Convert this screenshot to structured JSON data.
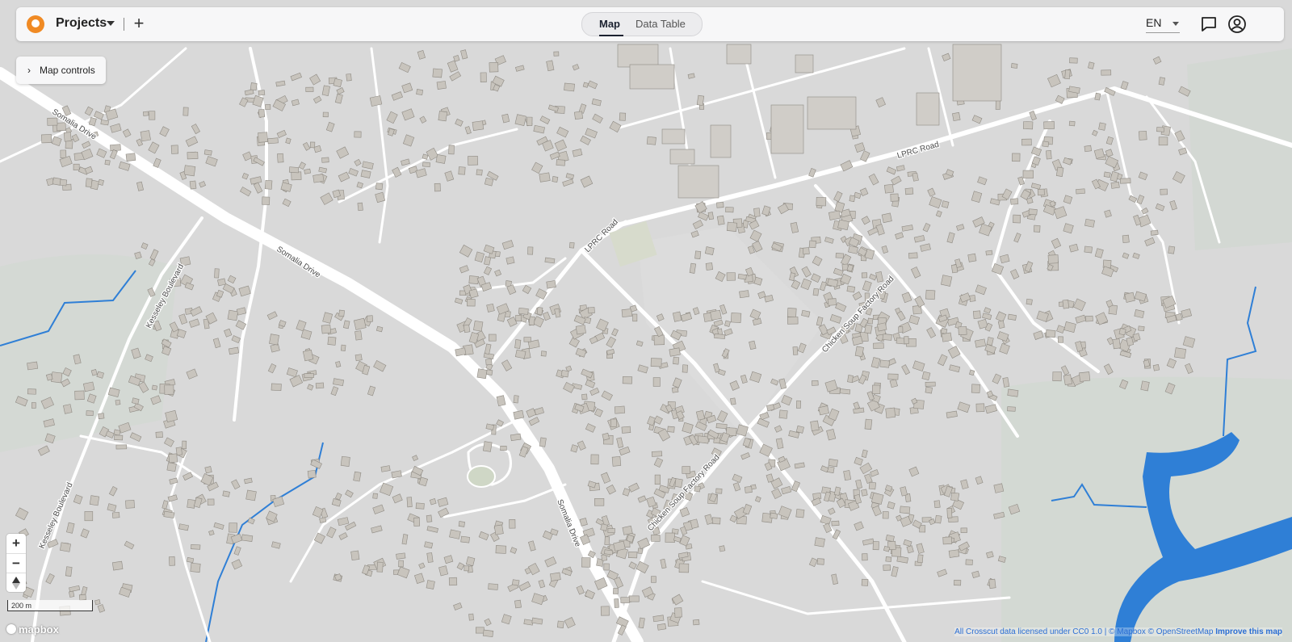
{
  "app": {
    "title": "Projects",
    "add_icon": "plus-icon",
    "logo_color": "#f08a24"
  },
  "tabs": [
    {
      "label": "Map",
      "active": true
    },
    {
      "label": "Data Table",
      "active": false
    }
  ],
  "header": {
    "language": "EN",
    "feedback_icon": "chat-icon",
    "account_icon": "user-icon"
  },
  "map_controls": {
    "label": "Map controls",
    "icon": "chevron-right-icon"
  },
  "zoom": {
    "in": "+",
    "out": "−"
  },
  "scale": {
    "label": "200 m"
  },
  "branding": {
    "label": "mapbox"
  },
  "attribution": {
    "text": "All Crosscut data licensed under CC0 1.0 | © Mapbox © OpenStreetMap",
    "improve": "Improve this map"
  },
  "map": {
    "colors": {
      "land": "#d9d9d9",
      "road": "#ffffff",
      "building": "#c8c4bd",
      "building_stroke": "#8f8b84",
      "water": "#2f7fd6",
      "park": "#cfd7cf"
    },
    "labels": [
      "Somalia Drive",
      "Somalia Drive",
      "Somalia Drive",
      "Kesseley Boulevard",
      "Kesseley Boulevard",
      "LPRC Road",
      "LPRC Road",
      "Chicken Soup Factory Road",
      "Chicken Soup Factory Road"
    ]
  }
}
